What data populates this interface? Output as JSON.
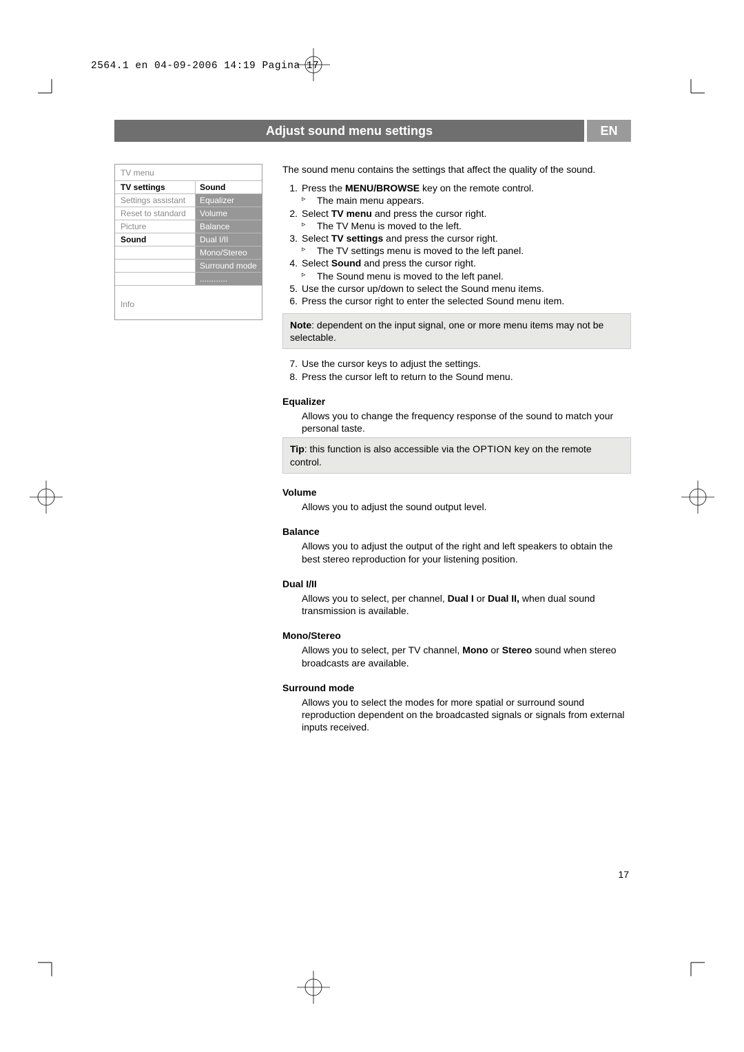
{
  "header": {
    "line": "2564.1 en  04-09-2006  14:19  Pagina 17"
  },
  "title": {
    "main": "Adjust sound menu settings",
    "lang": "EN"
  },
  "menu": {
    "header": "TV menu",
    "left": {
      "r1": "TV settings",
      "r2": "Settings assistant",
      "r3": "Reset to standard",
      "r4": "Picture",
      "r5": "Sound"
    },
    "right": {
      "r1": "Sound",
      "r2": "Equalizer",
      "r3": "Volume",
      "r4": "Balance",
      "r5": "Dual I/II",
      "r6": "Mono/Stereo",
      "r7": "Surround mode",
      "r8": "............"
    },
    "info": "Info"
  },
  "content": {
    "intro": "The sound menu contains the settings that affect the quality of the sound.",
    "steps": {
      "s1a": "Press the ",
      "s1b": "MENU/BROWSE",
      "s1c": " key on the remote control.",
      "s1sub": "The main menu appears.",
      "s2a": "Select ",
      "s2b": "TV menu",
      "s2c": " and press the cursor right.",
      "s2sub": "The TV Menu is moved to the left.",
      "s3a": "Select ",
      "s3b": "TV settings",
      "s3c": " and press the cursor right.",
      "s3sub": "The TV settings menu is moved to the left panel.",
      "s4a": "Select ",
      "s4b": "Sound",
      "s4c": " and press the cursor right.",
      "s4sub": "The Sound menu is moved to the left panel.",
      "s5": "Use the cursor up/down to select the Sound menu items.",
      "s6": "Press the cursor right to enter the selected Sound menu item.",
      "note_b": "Note",
      "note": ": dependent on the input signal, one or more menu items may not be selectable.",
      "s7": "Use the cursor keys to adjust the settings.",
      "s8": "Press the cursor left to return to the Sound menu."
    },
    "sections": {
      "equalizer": {
        "head": "Equalizer",
        "body": "Allows you to change the frequency response of the sound to match your personal taste.",
        "tip_b": "Tip",
        "tip1": ": this function is also accessible via the ",
        "tip_sc": "OPTION",
        "tip2": " key on the remote control."
      },
      "volume": {
        "head": "Volume",
        "body": "Allows you to adjust the sound output level."
      },
      "balance": {
        "head": "Balance",
        "body": "Allows you to adjust the output of the right and left speakers to obtain the best stereo reproduction for your listening position."
      },
      "dual": {
        "head": "Dual I/II",
        "b1": "Allows you to select, per channel, ",
        "b2": "Dual I",
        "b3": " or ",
        "b4": "Dual II,",
        "b5": " when dual sound transmission is available."
      },
      "mono": {
        "head": "Mono/Stereo",
        "b1": "Allows you to select, per TV channel, ",
        "b2": "Mono",
        "b3": " or ",
        "b4": "Stereo",
        "b5": " sound when stereo broadcasts are available."
      },
      "surround": {
        "head": "Surround mode",
        "body": "Allows you to select the modes for more spatial or surround sound reproduction dependent on the broadcasted signals or signals from external inputs received."
      }
    }
  },
  "page_num": "17"
}
